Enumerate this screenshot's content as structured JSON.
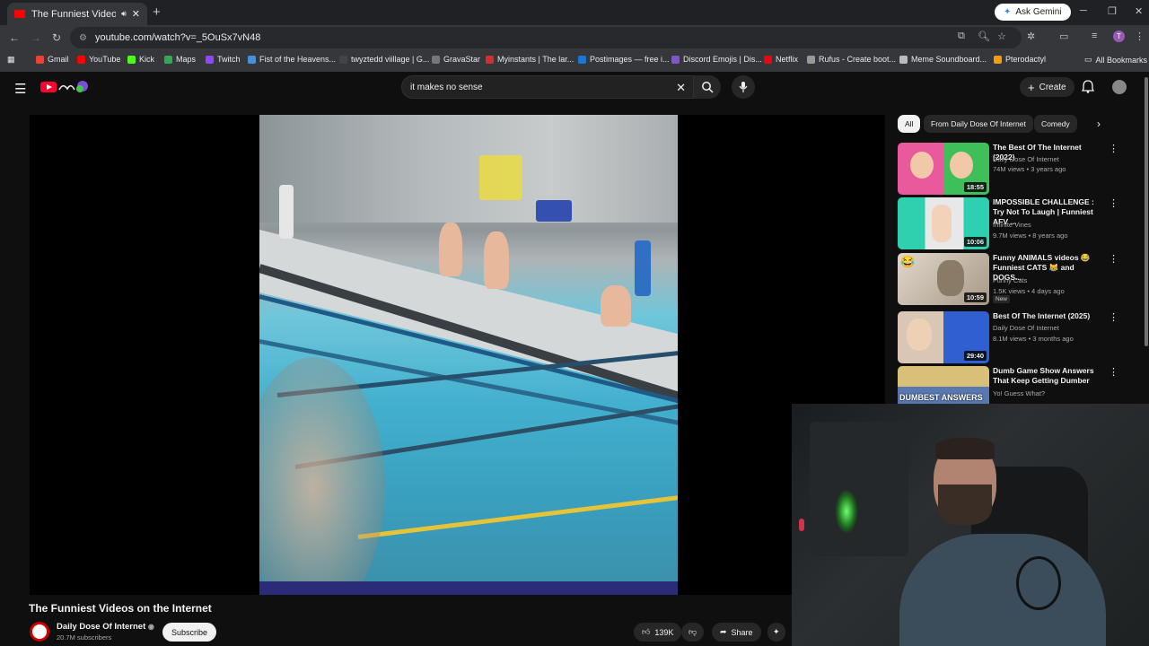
{
  "browser": {
    "tab_title": "The Funniest Videos on the",
    "ask_gemini": "Ask Gemini",
    "url": "youtube.com/watch?v=_5OuSx7vN48",
    "bookmarks": [
      {
        "label": "Gmail",
        "color": "#ea4335"
      },
      {
        "label": "YouTube",
        "color": "#ff0000"
      },
      {
        "label": "Kick",
        "color": "#53fc18"
      },
      {
        "label": "Maps",
        "color": "#34a853"
      },
      {
        "label": "Twitch",
        "color": "#9146ff"
      },
      {
        "label": "Fist of the Heavens...",
        "color": "#4a90d9"
      },
      {
        "label": "twyztedd viillage | G...",
        "color": "#444444"
      },
      {
        "label": "GravaStar",
        "color": "#777777"
      },
      {
        "label": "Myinstants | The lar...",
        "color": "#d32f2f"
      },
      {
        "label": "Postimages — free i...",
        "color": "#1976d2"
      },
      {
        "label": "Discord Emojis | Dis...",
        "color": "#7e57c2"
      },
      {
        "label": "Netflix",
        "color": "#e50914"
      },
      {
        "label": "Rufus - Create boot...",
        "color": "#999999"
      },
      {
        "label": "Meme Soundboard...",
        "color": "#bbbbbb"
      },
      {
        "label": "Pterodactyl",
        "color": "#f39c12"
      }
    ],
    "all_bookmarks": "All Bookmarks",
    "profile_initial": "T"
  },
  "youtube": {
    "search_query": "it makes no sense",
    "create_label": "Create",
    "video_title": "The Funniest Videos on the Internet",
    "channel_name": "Daily Dose Of Internet",
    "channel_subs": "20.7M subscribers",
    "subscribe_label": "Subscribe",
    "like_count": "139K",
    "share_label": "Share",
    "chips": [
      "All",
      "From Daily Dose Of Internet",
      "Comedy"
    ],
    "recommendations": [
      {
        "title": "The Best Of The Internet (2022)",
        "channel": "Daily Dose Of Internet",
        "meta": "74M views • 3 years ago",
        "duration": "18:55",
        "colors": [
          "#e85a9b",
          "#3fbf5a"
        ]
      },
      {
        "title": "IMPOSSIBLE CHALLENGE : Try Not To Laugh | Funniest AFV ...",
        "channel": "Infinite Vines",
        "meta": "9.7M views • 8 years ago",
        "duration": "10:06",
        "colors": [
          "#2fd0b0",
          "#e8e8e8"
        ]
      },
      {
        "title": "Funny ANIMALS videos 😂 Funniest CATS 😹 and DOGS...",
        "channel": "Funny Cats",
        "meta": "1.5K views • 4 days ago",
        "duration": "10:59",
        "badge": "New",
        "colors": [
          "#cfc6b8",
          "#7a6b5a"
        ]
      },
      {
        "title": "Best Of The Internet (2025)",
        "channel": "Daily Dose Of Internet",
        "meta": "8.1M views • 3 months ago",
        "duration": "29:40",
        "colors": [
          "#c9b9a8",
          "#2f5fd0"
        ]
      },
      {
        "title": "Dumb Game Show Answers That Keep Getting Dumber",
        "channel": "Yo! Guess What?",
        "meta": "",
        "duration": "",
        "thumb_text": "DUMBEST ANSWERS",
        "colors": [
          "#d8c078",
          "#5a78b0"
        ]
      }
    ]
  }
}
